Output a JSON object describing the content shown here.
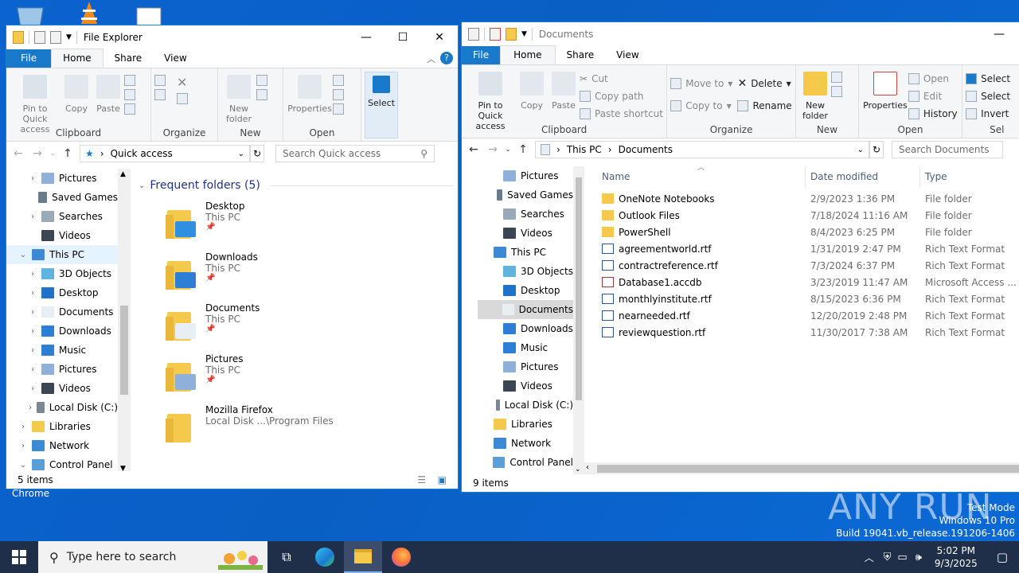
{
  "desktop": {
    "chrome_label": "Chrome",
    "watermark": "ANY RUN",
    "winver": {
      "line1": "Test Mode",
      "line2": "Windows 10 Pro",
      "line3": "Build 19041.vb_release.191206-1406"
    }
  },
  "left_window": {
    "title": "File Explorer",
    "tabs": [
      "File",
      "Home",
      "Share",
      "View"
    ],
    "ribbon": {
      "clipboard": {
        "pin": "Pin to Quick access",
        "copy": "Copy",
        "paste": "Paste",
        "label": "Clipboard"
      },
      "organize": {
        "label": "Organize"
      },
      "new": {
        "new_folder": "New folder",
        "label": "New"
      },
      "open": {
        "properties": "Properties",
        "label": "Open"
      },
      "select": {
        "select": "Select"
      }
    },
    "address": {
      "path": "Quick access",
      "search_placeholder": "Search Quick access"
    },
    "nav": [
      "Pictures",
      "Saved Games",
      "Searches",
      "Videos",
      "This PC",
      "3D Objects",
      "Desktop",
      "Documents",
      "Downloads",
      "Music",
      "Pictures",
      "Videos",
      "Local Disk (C:)",
      "Libraries",
      "Network",
      "Control Panel"
    ],
    "section_title": "Frequent folders (5)",
    "frequent": [
      {
        "name": "Desktop",
        "sub": "This PC"
      },
      {
        "name": "Downloads",
        "sub": "This PC"
      },
      {
        "name": "Documents",
        "sub": "This PC"
      },
      {
        "name": "Pictures",
        "sub": "This PC"
      },
      {
        "name": "Mozilla Firefox",
        "sub": "Local Disk ...\\Program Files"
      }
    ],
    "status": "5 items"
  },
  "right_window": {
    "title": "Documents",
    "tabs": [
      "File",
      "Home",
      "Share",
      "View"
    ],
    "ribbon": {
      "clipboard": {
        "pin": "Pin to Quick access",
        "copy": "Copy",
        "paste": "Paste",
        "cut": "Cut",
        "copy_path": "Copy path",
        "paste_shortcut": "Paste shortcut",
        "label": "Clipboard"
      },
      "organize": {
        "move_to": "Move to",
        "copy_to": "Copy to",
        "delete": "Delete",
        "rename": "Rename",
        "label": "Organize"
      },
      "new": {
        "new_folder": "New folder",
        "label": "New"
      },
      "open": {
        "properties": "Properties",
        "open": "Open",
        "edit": "Edit",
        "history": "History",
        "label": "Open"
      },
      "select": {
        "select_all": "Select",
        "select_none": "Select",
        "invert": "Invert",
        "label": "Sel"
      }
    },
    "address": {
      "crumb1": "This PC",
      "crumb2": "Documents",
      "search_placeholder": "Search Documents"
    },
    "nav": [
      "Pictures",
      "Saved Games",
      "Searches",
      "Videos",
      "This PC",
      "3D Objects",
      "Desktop",
      "Documents",
      "Downloads",
      "Music",
      "Pictures",
      "Videos",
      "Local Disk (C:)",
      "Libraries",
      "Network",
      "Control Panel"
    ],
    "columns": {
      "name": "Name",
      "date": "Date modified",
      "type": "Type"
    },
    "files": [
      {
        "name": "OneNote Notebooks",
        "date": "2/9/2023 1:36 PM",
        "type": "File folder",
        "kind": "folder"
      },
      {
        "name": "Outlook Files",
        "date": "7/18/2024 11:16 AM",
        "type": "File folder",
        "kind": "folder"
      },
      {
        "name": "PowerShell",
        "date": "8/4/2023 6:25 PM",
        "type": "File folder",
        "kind": "folder"
      },
      {
        "name": "agreementworld.rtf",
        "date": "1/31/2019 2:47 PM",
        "type": "Rich Text Format",
        "kind": "rtf"
      },
      {
        "name": "contractreference.rtf",
        "date": "7/3/2024 6:37 PM",
        "type": "Rich Text Format",
        "kind": "rtf"
      },
      {
        "name": "Database1.accdb",
        "date": "3/23/2019 11:47 AM",
        "type": "Microsoft Access ...",
        "kind": "access"
      },
      {
        "name": "monthlyinstitute.rtf",
        "date": "8/15/2023 6:36 PM",
        "type": "Rich Text Format",
        "kind": "rtf"
      },
      {
        "name": "nearneeded.rtf",
        "date": "12/20/2019 2:48 PM",
        "type": "Rich Text Format",
        "kind": "rtf"
      },
      {
        "name": "reviewquestion.rtf",
        "date": "11/30/2017 7:38 AM",
        "type": "Rich Text Format",
        "kind": "rtf"
      }
    ],
    "status": "9 items"
  },
  "taskbar": {
    "search_placeholder": "Type here to search",
    "time": "5:02 PM",
    "date": "9/3/2025"
  },
  "colors": {
    "accent": "#1979ca",
    "taskbar": "#1f2f4a",
    "folder": "#f5c94c",
    "desktop": "#0a5fc4"
  }
}
